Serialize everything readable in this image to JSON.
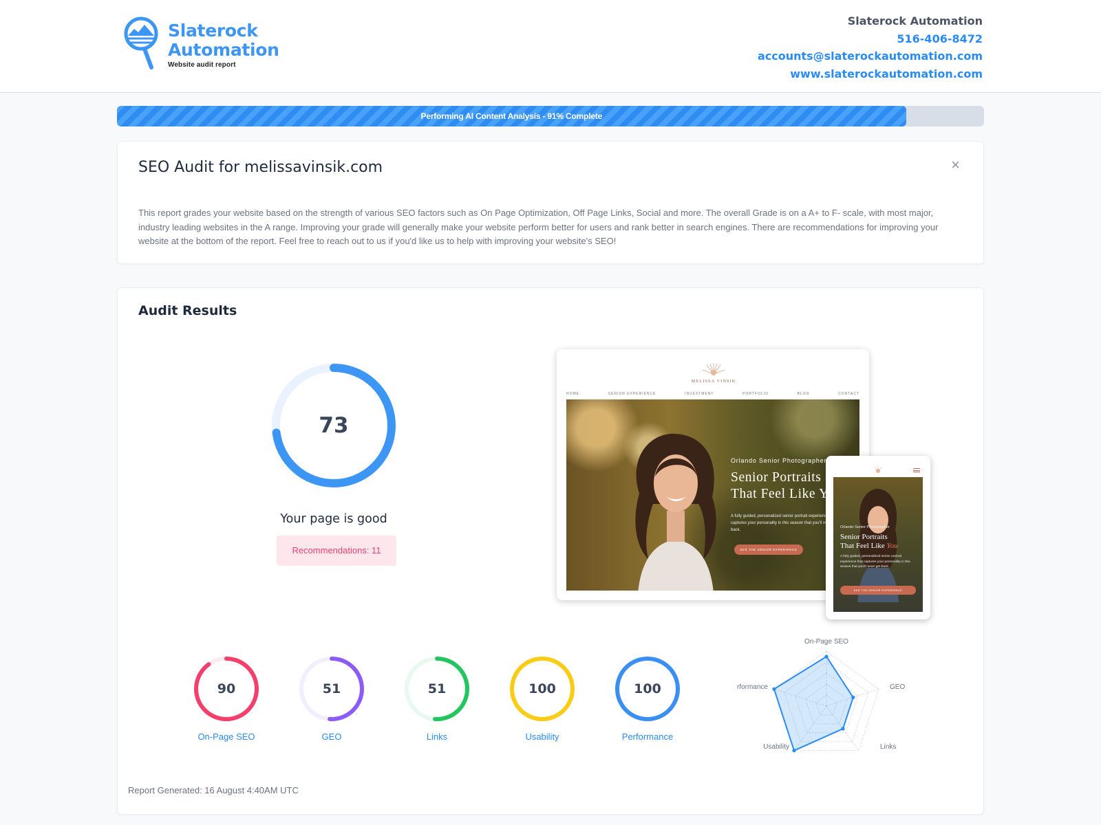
{
  "brand": {
    "line1": "Slaterock",
    "line2": "Automation",
    "subtitle": "Website audit report",
    "accent": "#3d96f3"
  },
  "contact": {
    "company": "Slaterock Automation",
    "phone": "516-406-8472",
    "email": "accounts@slaterockautomation.com",
    "website": "www.slaterockautomation.com"
  },
  "progress": {
    "label": "Performing AI Content Analysis - 91% Complete",
    "percent": 91
  },
  "intro": {
    "title": "SEO Audit for melissavinsik.com",
    "close_icon": "×",
    "description": "This report grades your website based on the strength of various SEO factors such as On Page Optimization, Off Page Links, Social and more. The overall Grade is on a A+ to F- scale, with most major, industry leading websites in the A range. Improving your grade will generally make your website perform better for users and rank better in search engines. There are recommendations for improving your website at the bottom of the report. Feel free to reach out to us if you'd like us to help with improving your website's SEO!"
  },
  "results": {
    "title": "Audit Results",
    "overall_score": 73,
    "overall_text": "73",
    "status": "Your page is good",
    "recommendations": "Recommendations: 11",
    "overall_color": "#3d96f3",
    "scores": [
      {
        "name": "On-Page SEO",
        "value": 90,
        "text": "90",
        "color": "#f43f6b"
      },
      {
        "name": "GEO",
        "value": 51,
        "text": "51",
        "color": "#8b5cf6"
      },
      {
        "name": "Links",
        "value": 51,
        "text": "51",
        "color": "#22c55e"
      },
      {
        "name": "Usability",
        "value": 100,
        "text": "100",
        "color": "#facc15"
      },
      {
        "name": "Performance",
        "value": 100,
        "text": "100",
        "color": "#3b8ff3"
      }
    ],
    "report_generated": "Report Generated: 16 August 4:40AM UTC"
  },
  "preview": {
    "site_name": "MELISSA VINSIK",
    "nav": [
      "HOME",
      "SENIOR EXPERIENCE",
      "INVESTMENT",
      "PORTFOLIO",
      "BLOG",
      "CONTACT"
    ],
    "desktop_kicker": "Orlando Senior Photographer",
    "desktop_headline_1": "Senior Portraits",
    "desktop_headline_2": "That Feel Like You",
    "desktop_body": "A fully guided, personalized senior portrait experience that captures your personality in this season that you'll never get back.",
    "desktop_button": "SEE THE SENIOR EXPERIENCE",
    "phone_kicker": "Orlando Senior Photographer",
    "phone_headline_1": "Senior Portraits",
    "phone_headline_2": "That Feel Like",
    "phone_headline_you": "You",
    "phone_body": "A fully guided, personalized senior portrait experience that captures your personality in this season that you'll never get back.",
    "phone_button": "SEE THE SENIOR EXPERIENCE"
  },
  "chart_data": {
    "type": "radar",
    "axes": [
      "On-Page SEO",
      "GEO",
      "Links",
      "Usability",
      "Performance"
    ],
    "values": [
      90,
      51,
      51,
      100,
      100
    ],
    "range": [
      0,
      100
    ],
    "rings": 5,
    "color": "#2a8bf2"
  }
}
